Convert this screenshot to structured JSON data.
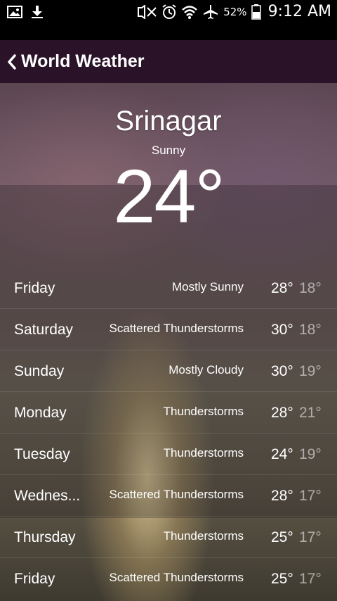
{
  "status_bar": {
    "battery_percent": "52%",
    "time": "9:12 AM",
    "icons": [
      "gallery-icon",
      "download-icon",
      "mute-icon",
      "alarm-icon",
      "wifi-icon",
      "airplane-icon",
      "battery-icon"
    ]
  },
  "action_bar": {
    "title": "World Weather"
  },
  "current": {
    "city": "Srinagar",
    "condition": "Sunny",
    "temperature": "24°"
  },
  "forecast": [
    {
      "day": "Friday",
      "condition": "Mostly Sunny",
      "high": "28°",
      "low": "18°"
    },
    {
      "day": "Saturday",
      "condition": "Scattered Thunderstorms",
      "high": "30°",
      "low": "18°"
    },
    {
      "day": "Sunday",
      "condition": "Mostly Cloudy",
      "high": "30°",
      "low": "19°"
    },
    {
      "day": "Monday",
      "condition": "Thunderstorms",
      "high": "28°",
      "low": "21°"
    },
    {
      "day": "Tuesday",
      "condition": "Thunderstorms",
      "high": "24°",
      "low": "19°"
    },
    {
      "day": "Wednes...",
      "condition": "Scattered Thunderstorms",
      "high": "28°",
      "low": "17°"
    },
    {
      "day": "Thursday",
      "condition": "Thunderstorms",
      "high": "25°",
      "low": "17°"
    },
    {
      "day": "Friday",
      "condition": "Scattered Thunderstorms",
      "high": "25°",
      "low": "17°"
    }
  ]
}
